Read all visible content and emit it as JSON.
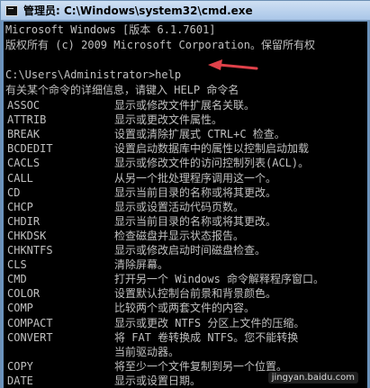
{
  "window": {
    "title": "管理员: C:\\Windows\\system32\\cmd.exe"
  },
  "console": {
    "header": [
      "Microsoft Windows [版本 6.1.7601]",
      "版权所有 (c) 2009 Microsoft Corporation。保留所有权"
    ],
    "prompt": "C:\\Users\\Administrator>help",
    "intro": "有关某个命令的详细信息，请键入 HELP 命令名",
    "commands": [
      {
        "cmd": "ASSOC",
        "desc": "显示或修改文件扩展名关联。"
      },
      {
        "cmd": "ATTRIB",
        "desc": "显示或更改文件属性。"
      },
      {
        "cmd": "BREAK",
        "desc": "设置或清除扩展式 CTRL+C 检查。"
      },
      {
        "cmd": "BCDEDIT",
        "desc": "设置启动数据库中的属性以控制启动加载"
      },
      {
        "cmd": "CACLS",
        "desc": "显示或修改文件的访问控制列表(ACL)。"
      },
      {
        "cmd": "CALL",
        "desc": "从另一个批处理程序调用这一个。"
      },
      {
        "cmd": "CD",
        "desc": "显示当前目录的名称或将其更改。"
      },
      {
        "cmd": "CHCP",
        "desc": "显示或设置活动代码页数。"
      },
      {
        "cmd": "CHDIR",
        "desc": "显示当前目录的名称或将其更改。"
      },
      {
        "cmd": "CHKDSK",
        "desc": "检查磁盘并显示状态报告。"
      },
      {
        "cmd": "CHKNTFS",
        "desc": "显示或修改启动时间磁盘检查。"
      },
      {
        "cmd": "CLS",
        "desc": "清除屏幕。"
      },
      {
        "cmd": "CMD",
        "desc": "打开另一个 Windows 命令解释程序窗口。"
      },
      {
        "cmd": "COLOR",
        "desc": "设置默认控制台前景和背景颜色。"
      },
      {
        "cmd": "COMP",
        "desc": "比较两个或两套文件的内容。"
      },
      {
        "cmd": "COMPACT",
        "desc": "显示或更改 NTFS 分区上文件的压缩。"
      },
      {
        "cmd": "CONVERT",
        "desc": "将 FAT 卷转换成 NTFS。您不能转换"
      },
      {
        "cmd": "",
        "desc": "当前驱动器。"
      },
      {
        "cmd": "COPY",
        "desc": "将至少一个文件复制到另一个位置。"
      },
      {
        "cmd": "DATE",
        "desc": "显示或设置日期。"
      }
    ]
  },
  "watermark": "jingyan.baidu.com",
  "colors": {
    "console_bg": "#000000",
    "console_text": "#c0c0c0",
    "arrow": "#e0414a"
  }
}
